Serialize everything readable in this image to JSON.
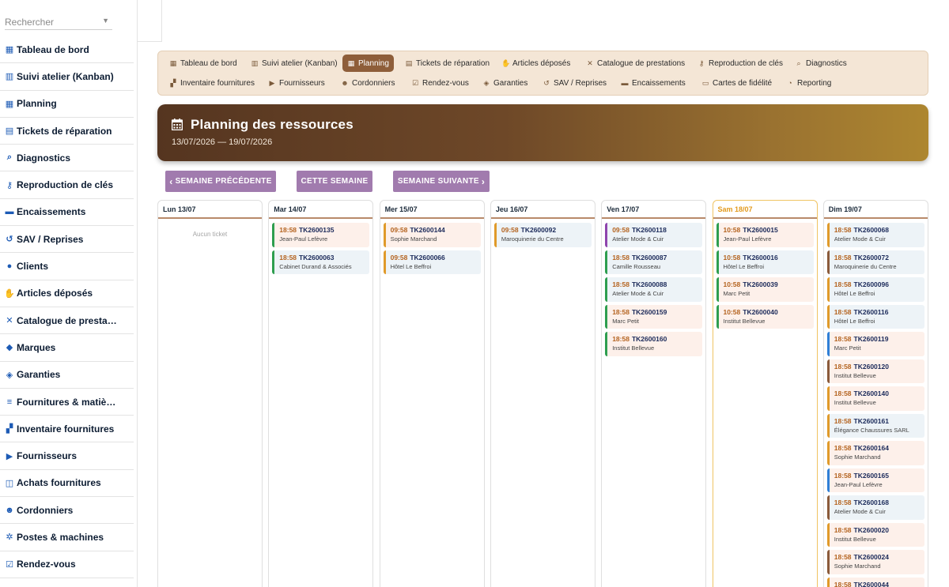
{
  "search": {
    "placeholder": "Rechercher"
  },
  "sidebar": {
    "items": [
      {
        "label": "Tableau de bord",
        "icon": "dashboard-icon"
      },
      {
        "label": "Suivi atelier (Kanban)",
        "icon": "kanban-icon"
      },
      {
        "label": "Planning",
        "icon": "calendar-icon"
      },
      {
        "label": "Tickets de réparation",
        "icon": "ticket-icon"
      },
      {
        "label": "Diagnostics",
        "icon": "search-icon"
      },
      {
        "label": "Reproduction de clés",
        "icon": "key-icon"
      },
      {
        "label": "Encaissements",
        "icon": "cash-icon"
      },
      {
        "label": "SAV / Reprises",
        "icon": "undo-icon"
      },
      {
        "label": "Clients",
        "icon": "user-icon"
      },
      {
        "label": "Articles déposés",
        "icon": "hand-icon"
      },
      {
        "label": "Catalogue de prestations",
        "icon": "tools-icon"
      },
      {
        "label": "Marques",
        "icon": "tag-icon"
      },
      {
        "label": "Garanties",
        "icon": "shield-icon"
      },
      {
        "label": "Fournitures & matières",
        "icon": "layers-icon"
      },
      {
        "label": "Inventaire fournitures",
        "icon": "boxes-icon"
      },
      {
        "label": "Fournisseurs",
        "icon": "truck-icon"
      },
      {
        "label": "Achats fournitures",
        "icon": "cart-icon"
      },
      {
        "label": "Cordonniers",
        "icon": "users-cog-icon"
      },
      {
        "label": "Postes & machines",
        "icon": "gears-icon"
      },
      {
        "label": "Rendez-vous",
        "icon": "calendar-check-icon"
      }
    ]
  },
  "topmenu": {
    "row1": [
      {
        "label": "Tableau de bord",
        "icon": "dashboard-icon"
      },
      {
        "label": "Suivi atelier (Kanban)",
        "icon": "kanban-icon"
      },
      {
        "label": "Planning",
        "icon": "calendar-icon",
        "active": true
      },
      {
        "label": "Tickets de réparation",
        "icon": "ticket-icon"
      },
      {
        "label": "Articles déposés",
        "icon": "hand-icon"
      },
      {
        "label": "Catalogue de prestations",
        "icon": "tools-icon"
      },
      {
        "label": "Reproduction de clés",
        "icon": "key-icon"
      },
      {
        "label": "Diagnostics",
        "icon": "search-icon"
      }
    ],
    "row2": [
      {
        "label": "Inventaire fournitures",
        "icon": "boxes-icon"
      },
      {
        "label": "Fournisseurs",
        "icon": "truck-icon"
      },
      {
        "label": "Cordonniers",
        "icon": "users-cog-icon"
      },
      {
        "label": "Rendez-vous",
        "icon": "calendar-check-icon"
      },
      {
        "label": "Garanties",
        "icon": "shield-icon"
      },
      {
        "label": "SAV / Reprises",
        "icon": "undo-icon"
      },
      {
        "label": "Encaissements",
        "icon": "cash-icon"
      },
      {
        "label": "Cartes de fidélité",
        "icon": "card-icon"
      },
      {
        "label": "Reporting",
        "icon": "pie-icon"
      }
    ]
  },
  "hero": {
    "title": "Planning des ressources",
    "dates": "13/07/2026 — 19/07/2026"
  },
  "week_nav": {
    "prev": "SEMAINE PRÉCÉDENTE",
    "current": "CETTE SEMAINE",
    "next": "SEMAINE SUIVANTE"
  },
  "colors": {
    "accent": "#8e5e3a",
    "button": "#a17bae",
    "today_border": "#f0c463",
    "border_green": "#2e9e4f",
    "border_orange": "#e09a2a",
    "border_brown": "#8a5a3a",
    "border_purple": "#8e44ad",
    "border_blue": "#2f7fd6",
    "bg_pink": "#fdf0ea",
    "bg_blue": "#edf3f7"
  },
  "calendar": {
    "empty_message": "Aucun ticket",
    "days": [
      {
        "label": "Lun 13/07",
        "tickets": []
      },
      {
        "label": "Mar 14/07",
        "tickets": [
          {
            "time": "18:58",
            "code": "TK2600135",
            "client": "Jean-Paul Lefèvre",
            "border": "green",
            "bg": "pink"
          },
          {
            "time": "18:58",
            "code": "TK2600063",
            "client": "Cabinet Durand & Associés",
            "border": "green",
            "bg": "blue"
          }
        ]
      },
      {
        "label": "Mer 15/07",
        "tickets": [
          {
            "time": "09:58",
            "code": "TK2600144",
            "client": "Sophie Marchand",
            "border": "orange",
            "bg": "pink"
          },
          {
            "time": "09:58",
            "code": "TK2600066",
            "client": "Hôtel Le Beffroi",
            "border": "orange",
            "bg": "blue"
          }
        ]
      },
      {
        "label": "Jeu 16/07",
        "tickets": [
          {
            "time": "09:58",
            "code": "TK2600092",
            "client": "Maroquinerie du Centre",
            "border": "orange",
            "bg": "blue"
          }
        ]
      },
      {
        "label": "Ven 17/07",
        "tickets": [
          {
            "time": "09:58",
            "code": "TK2600118",
            "client": "Atelier Mode & Cuir",
            "border": "purple",
            "bg": "blue"
          },
          {
            "time": "18:58",
            "code": "TK2600087",
            "client": "Camille Rousseau",
            "border": "green",
            "bg": "blue"
          },
          {
            "time": "18:58",
            "code": "TK2600088",
            "client": "Atelier Mode & Cuir",
            "border": "green",
            "bg": "blue"
          },
          {
            "time": "18:58",
            "code": "TK2600159",
            "client": "Marc Petit",
            "border": "green",
            "bg": "pink"
          },
          {
            "time": "18:58",
            "code": "TK2600160",
            "client": "Institut Bellevue",
            "border": "green",
            "bg": "pink"
          }
        ]
      },
      {
        "label": "Sam 18/07",
        "today": true,
        "tickets": [
          {
            "time": "10:58",
            "code": "TK2600015",
            "client": "Jean-Paul Lefèvre",
            "border": "green",
            "bg": "pink"
          },
          {
            "time": "10:58",
            "code": "TK2600016",
            "client": "Hôtel Le Beffroi",
            "border": "green",
            "bg": "blue"
          },
          {
            "time": "10:58",
            "code": "TK2600039",
            "client": "Marc Petit",
            "border": "green",
            "bg": "pink"
          },
          {
            "time": "10:58",
            "code": "TK2600040",
            "client": "Institut Bellevue",
            "border": "green",
            "bg": "pink"
          }
        ]
      },
      {
        "label": "Dim 19/07",
        "tickets": [
          {
            "time": "18:58",
            "code": "TK2600068",
            "client": "Atelier Mode & Cuir",
            "border": "orange",
            "bg": "blue"
          },
          {
            "time": "18:58",
            "code": "TK2600072",
            "client": "Maroquinerie du Centre",
            "border": "brown",
            "bg": "blue"
          },
          {
            "time": "18:58",
            "code": "TK2600096",
            "client": "Hôtel Le Beffroi",
            "border": "orange",
            "bg": "blue"
          },
          {
            "time": "18:58",
            "code": "TK2600116",
            "client": "Hôtel Le Beffroi",
            "border": "orange",
            "bg": "blue"
          },
          {
            "time": "18:58",
            "code": "TK2600119",
            "client": "Marc Petit",
            "border": "blue",
            "bg": "pink"
          },
          {
            "time": "18:58",
            "code": "TK2600120",
            "client": "Institut Bellevue",
            "border": "brown",
            "bg": "pink"
          },
          {
            "time": "18:58",
            "code": "TK2600140",
            "client": "Institut Bellevue",
            "border": "orange",
            "bg": "pink"
          },
          {
            "time": "18:58",
            "code": "TK2600161",
            "client": "Élégance Chaussures SARL",
            "border": "orange",
            "bg": "blue"
          },
          {
            "time": "18:58",
            "code": "TK2600164",
            "client": "Sophie Marchand",
            "border": "orange",
            "bg": "pink"
          },
          {
            "time": "18:58",
            "code": "TK2600165",
            "client": "Jean-Paul Lefèvre",
            "border": "blue",
            "bg": "pink"
          },
          {
            "time": "18:58",
            "code": "TK2600168",
            "client": "Atelier Mode & Cuir",
            "border": "brown",
            "bg": "blue"
          },
          {
            "time": "18:58",
            "code": "TK2600020",
            "client": "Institut Bellevue",
            "border": "orange",
            "bg": "pink"
          },
          {
            "time": "18:58",
            "code": "TK2600024",
            "client": "Sophie Marchand",
            "border": "brown",
            "bg": "pink"
          },
          {
            "time": "18:58",
            "code": "TK2600044",
            "client": "",
            "border": "orange",
            "bg": "pink"
          }
        ]
      }
    ]
  }
}
